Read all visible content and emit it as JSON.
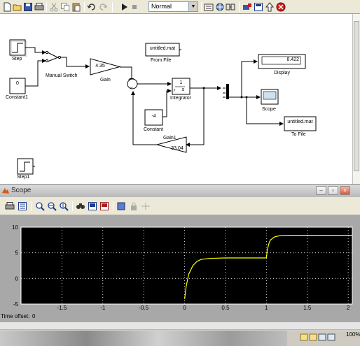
{
  "model_window": {
    "sim_mode": "Normal",
    "blocks": {
      "step": "Step",
      "manual_switch": "Manual Switch",
      "gain": "Gain",
      "gain_value": "4.35",
      "constant1": "Constant1",
      "constant1_value": "0",
      "from_file": "From File",
      "from_file_value": "untitled.mat",
      "integrator": "Integrator",
      "integrator_num": "1",
      "integrator_den": "s",
      "constant": "Constant",
      "constant_value": "-4",
      "gain1": "Gain1",
      "gain1_value": "33.04",
      "display": "Display",
      "display_value": "8.422",
      "scope": "Scope",
      "to_file": "To File",
      "to_file_value": "untitled.mat",
      "step1": "Step1"
    },
    "toolbar_icons": [
      "new-icon",
      "open-icon",
      "save-icon",
      "print-icon",
      "cut-icon",
      "copy-icon",
      "paste-icon",
      "undo-icon",
      "redo-icon",
      "play-icon",
      "stop-icon",
      "build-icon",
      "model-explorer-icon",
      "library-icon",
      "debug-icon",
      "up-icon",
      "stop-sign-icon"
    ]
  },
  "scope_window": {
    "title": "Scope",
    "window_buttons": [
      "–",
      "▫",
      "×"
    ],
    "toolbar_icons": [
      "print-icon",
      "parameters-icon",
      "zoom-icon",
      "zoom-x-icon",
      "zoom-y-icon",
      "autoscale-icon",
      "save-axes-icon",
      "restore-axes-icon",
      "floating-icon",
      "lock-icon",
      "signal-select-icon"
    ],
    "time_offset_label": "Time offset:",
    "time_offset_value": "0"
  },
  "taskbar": {
    "zoom": "100%"
  },
  "chart_data": {
    "type": "line",
    "xlim": [
      -2,
      2.05
    ],
    "ylim": [
      -5,
      10
    ],
    "xticks": [
      "-1.5",
      "-1",
      "-0.5",
      "0",
      "0.5",
      "1",
      "1.5",
      "2"
    ],
    "yticks": [
      "10",
      "5",
      "0",
      "-5"
    ],
    "grid": true,
    "background": "#000000",
    "line_color": "#ffff00",
    "series": [
      {
        "x": [
          0,
          0.02,
          0.05,
          0.1,
          0.15,
          0.2,
          0.3,
          0.5,
          0.8,
          1.0,
          1.01,
          1.03,
          1.05,
          1.1,
          1.15,
          1.2,
          1.3,
          1.6,
          2.05
        ],
        "y": [
          -4,
          -1.5,
          0.8,
          2.5,
          3.3,
          3.7,
          3.9,
          4.0,
          4.0,
          4.0,
          5.5,
          6.8,
          7.5,
          8.1,
          8.3,
          8.4,
          8.42,
          8.42,
          8.42
        ]
      }
    ]
  }
}
